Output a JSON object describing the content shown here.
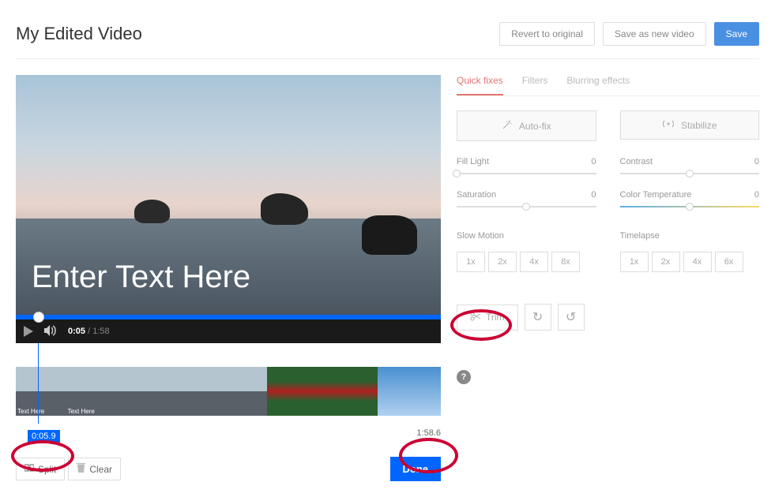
{
  "header": {
    "title": "My Edited Video",
    "revert": "Revert to original",
    "saveAs": "Save as new video",
    "save": "Save"
  },
  "video": {
    "overlayText": "Enter Text Here",
    "currentTime": "0:05",
    "totalTime": "1:58"
  },
  "timeline": {
    "clipText1": "Text Here",
    "clipText2": "Text Here",
    "markerLeft": "0:05.9",
    "markerRight": "1:58.6"
  },
  "actions": {
    "split": "Split",
    "clear": "Clear",
    "done": "Done"
  },
  "tabs": {
    "quickFixes": "Quick fixes",
    "filters": "Filters",
    "blurring": "Blurring effects"
  },
  "sidebar": {
    "autoFix": "Auto-fix",
    "stabilize": "Stabilize",
    "fillLight": {
      "label": "Fill Light",
      "value": "0",
      "pos": 0
    },
    "contrast": {
      "label": "Contrast",
      "value": "0",
      "pos": 50
    },
    "saturation": {
      "label": "Saturation",
      "value": "0",
      "pos": 50
    },
    "colorTemp": {
      "label": "Color Temperature",
      "value": "0",
      "pos": 50
    },
    "slowMotion": {
      "label": "Slow Motion",
      "opts": [
        "1x",
        "2x",
        "4x",
        "8x"
      ]
    },
    "timelapse": {
      "label": "Timelapse",
      "opts": [
        "1x",
        "2x",
        "4x",
        "6x"
      ]
    },
    "trim": "Trim",
    "help": "?"
  }
}
